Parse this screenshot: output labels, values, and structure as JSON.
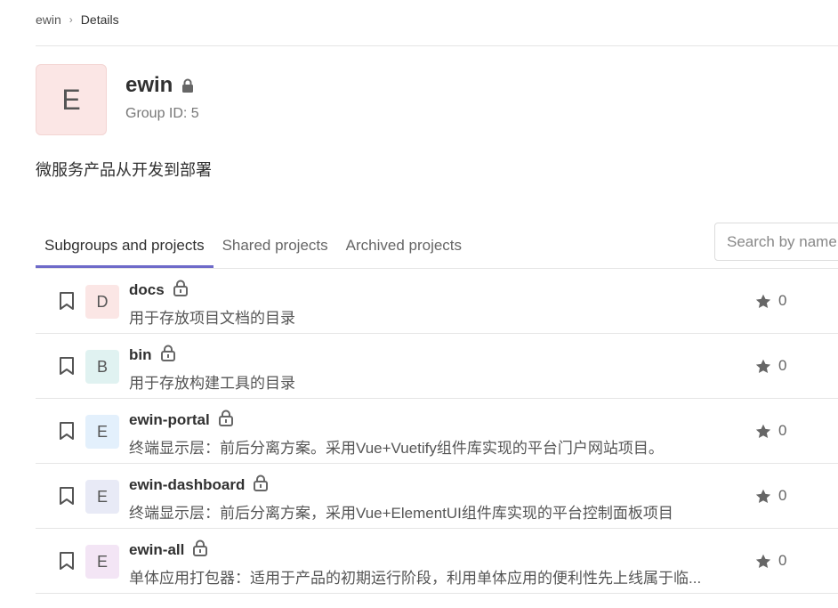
{
  "breadcrumb": {
    "parent": "ewin",
    "separator": "›",
    "current": "Details"
  },
  "group": {
    "avatar_letter": "E",
    "avatar_color": "#fbe6e5",
    "name": "ewin",
    "id_text": "Group ID: 5",
    "description": "微服务产品从开发到部署"
  },
  "tabs": [
    {
      "label": "Subgroups and projects",
      "active": true
    },
    {
      "label": "Shared projects",
      "active": false
    },
    {
      "label": "Archived projects",
      "active": false
    }
  ],
  "search": {
    "placeholder": "Search by name"
  },
  "accent_color": "#6e6ac9",
  "projects": [
    {
      "letter": "D",
      "color": "#fbe6e5",
      "name": "docs",
      "description": "用于存放项目文档的目录",
      "stars": "0"
    },
    {
      "letter": "B",
      "color": "#e0f2f1",
      "name": "bin",
      "description": "用于存放构建工具的目录",
      "stars": "0"
    },
    {
      "letter": "E",
      "color": "#e3f0fc",
      "name": "ewin-portal",
      "description": "终端显示层：前后分离方案。采用Vue+Vuetify组件库实现的平台门户网站项目。",
      "stars": "0"
    },
    {
      "letter": "E",
      "color": "#e8eaf6",
      "name": "ewin-dashboard",
      "description": "终端显示层：前后分离方案，采用Vue+ElementUI组件库实现的平台控制面板项目",
      "stars": "0"
    },
    {
      "letter": "E",
      "color": "#f3e5f5",
      "name": "ewin-all",
      "description": "单体应用打包器：适用于产品的初期运行阶段，利用单体应用的便利性先上线属于临...",
      "stars": "0"
    }
  ]
}
